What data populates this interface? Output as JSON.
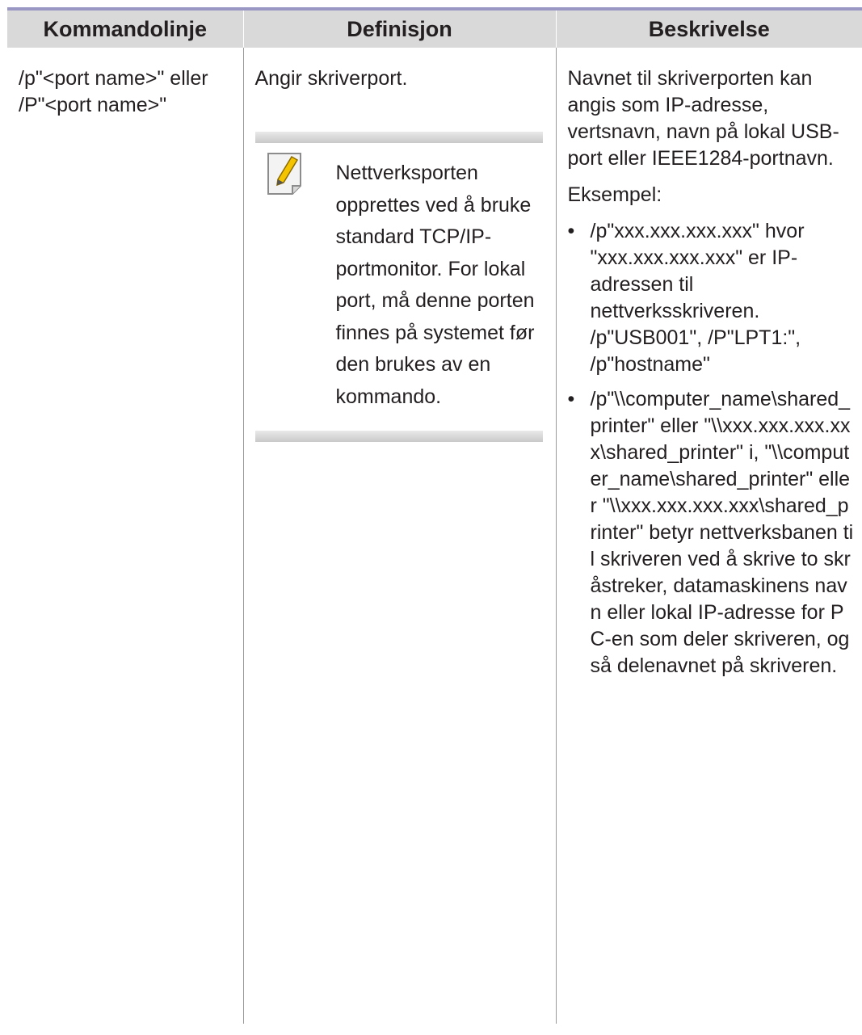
{
  "table": {
    "headers": [
      "Kommandolinje",
      "Definisjon",
      "Beskrivelse"
    ],
    "row": {
      "command": "/p\"<port name>\" eller /P\"<port name>\"",
      "definition": "Angir skriverport.",
      "note": {
        "icon": "note-pencil-icon",
        "text": "Nettverksporten opprettes ved å bruke standard TCP/IP-portmonitor. For lokal port, må denne porten finnes på systemet før den brukes av en kommando."
      },
      "description": {
        "intro": "Navnet til skriverporten kan angis som IP-adresse, vertsnavn, navn på lokal USB-port eller IEEE1284-portnavn.",
        "example_label": "Eksempel:",
        "bullet_symbol": "•",
        "bullets": [
          "/p\"xxx.xxx.xxx.xxx\" hvor \"xxx.xxx.xxx.xxx\" er IP-adressen til nettverksskriveren. /p\"USB001\", /P\"LPT1:\", /p\"hostname\"",
          "/p\"\\\\computer_name\\shared_printer\" eller \"\\\\xxx.xxx.xxx.xxx\\shared_printer\" i, \"\\\\computer_name\\shared_printer\" eller \"\\\\xxx.xxx.xxx.xxx\\shared_printer\" betyr nettverksbanen til skriveren ved å skrive to skråstreker, datamaskinens navn eller lokal IP-adresse for PC-en som deler skriveren, og så delenavnet på skriveren."
        ]
      }
    }
  }
}
